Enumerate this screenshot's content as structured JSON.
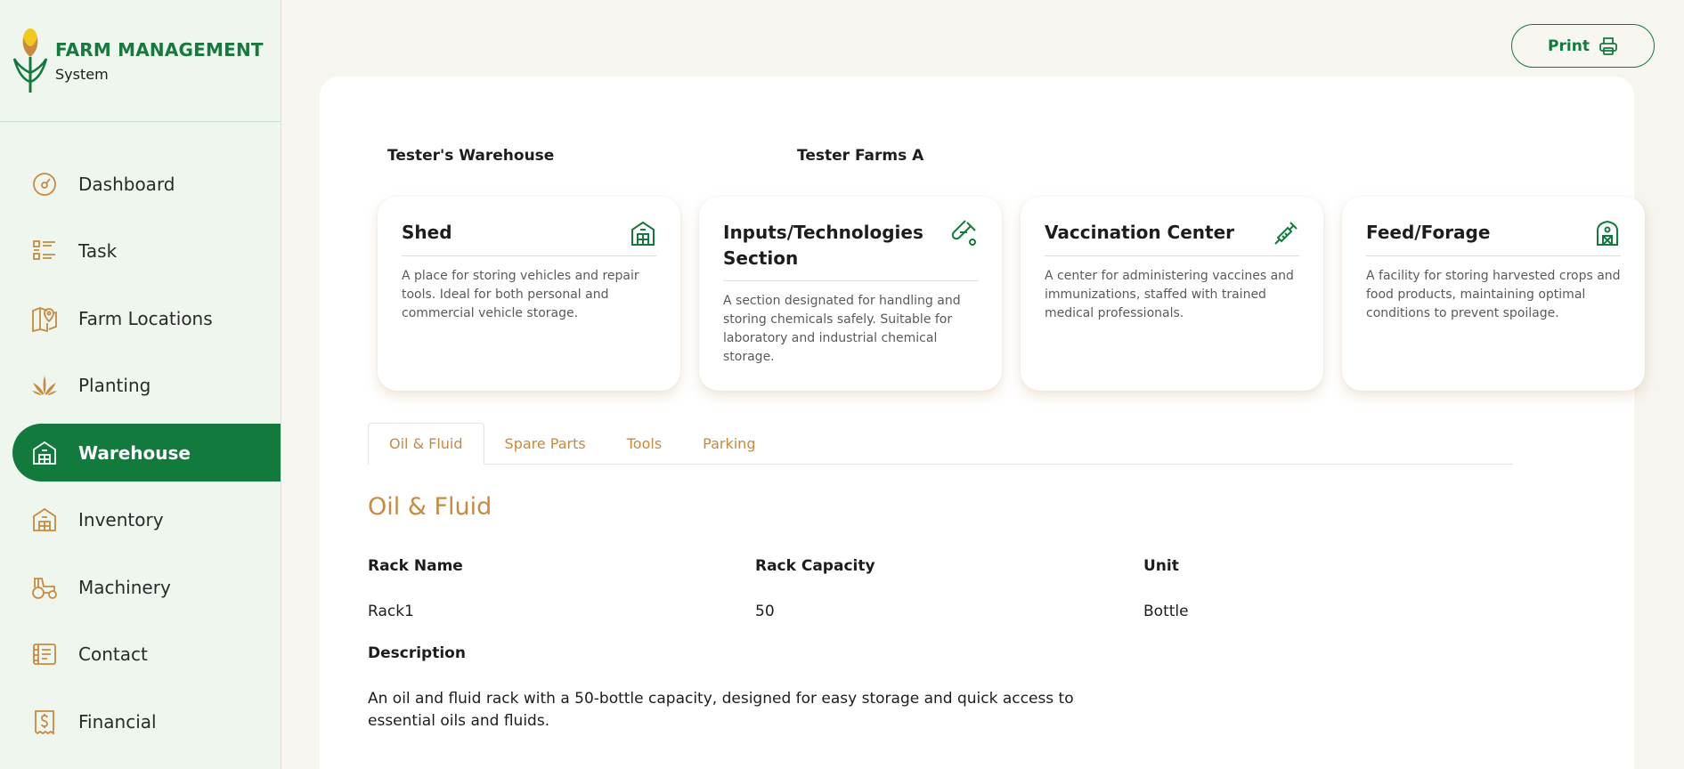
{
  "brand": {
    "title": "FARM MANAGEMENT",
    "subtitle": "System"
  },
  "sidebar": {
    "items": [
      {
        "label": "Dashboard",
        "icon": "dashboard-icon",
        "active": false
      },
      {
        "label": "Task",
        "icon": "task-list-icon",
        "active": false
      },
      {
        "label": "Farm Locations",
        "icon": "map-pin-icon",
        "active": false
      },
      {
        "label": "Planting",
        "icon": "plant-icon",
        "active": false
      },
      {
        "label": "Warehouse",
        "icon": "warehouse-icon",
        "active": true
      },
      {
        "label": "Inventory",
        "icon": "inventory-icon",
        "active": false
      },
      {
        "label": "Machinery",
        "icon": "tractor-icon",
        "active": false
      },
      {
        "label": "Contact",
        "icon": "contact-icon",
        "active": false
      },
      {
        "label": "Financial",
        "icon": "receipt-dollar-icon",
        "active": false
      }
    ]
  },
  "header": {
    "print_label": "Print"
  },
  "warehouse": {
    "name": "Tester's Warehouse",
    "farm": "Tester Farms A"
  },
  "cards": [
    {
      "title": "Shed",
      "icon": "shed-icon",
      "description": "A place for storing vehicles and repair tools. Ideal for both personal and commercial vehicle storage."
    },
    {
      "title": "Inputs/Technologies Section",
      "icon": "test-tube-icon",
      "description": "A section designated for handling and storing chemicals safely. Suitable for laboratory and industrial chemical storage."
    },
    {
      "title": "Vaccination Center",
      "icon": "syringe-icon",
      "description": "A center for administering vaccines and immunizations, staffed with trained medical professionals."
    },
    {
      "title": "Feed/Forage",
      "icon": "barn-icon",
      "description": "A facility for storing harvested crops and food products, maintaining optimal conditions to prevent spoilage."
    }
  ],
  "tabs": [
    {
      "label": "Oil & Fluid",
      "active": true
    },
    {
      "label": "Spare Parts",
      "active": false
    },
    {
      "label": "Tools",
      "active": false
    },
    {
      "label": "Parking",
      "active": false
    }
  ],
  "section": {
    "title": "Oil & Fluid",
    "columns": [
      "Rack Name",
      "Rack Capacity",
      "Unit"
    ],
    "row": [
      "Rack1",
      "50",
      "Bottle"
    ],
    "description_label": "Description",
    "description": "An oil and fluid rack with a 50-bottle capacity, designed for easy storage and quick access to essential oils and fluids."
  },
  "colors": {
    "primary": "#137a3e",
    "accent": "#c78a3f",
    "background": "#f6f5ef"
  }
}
